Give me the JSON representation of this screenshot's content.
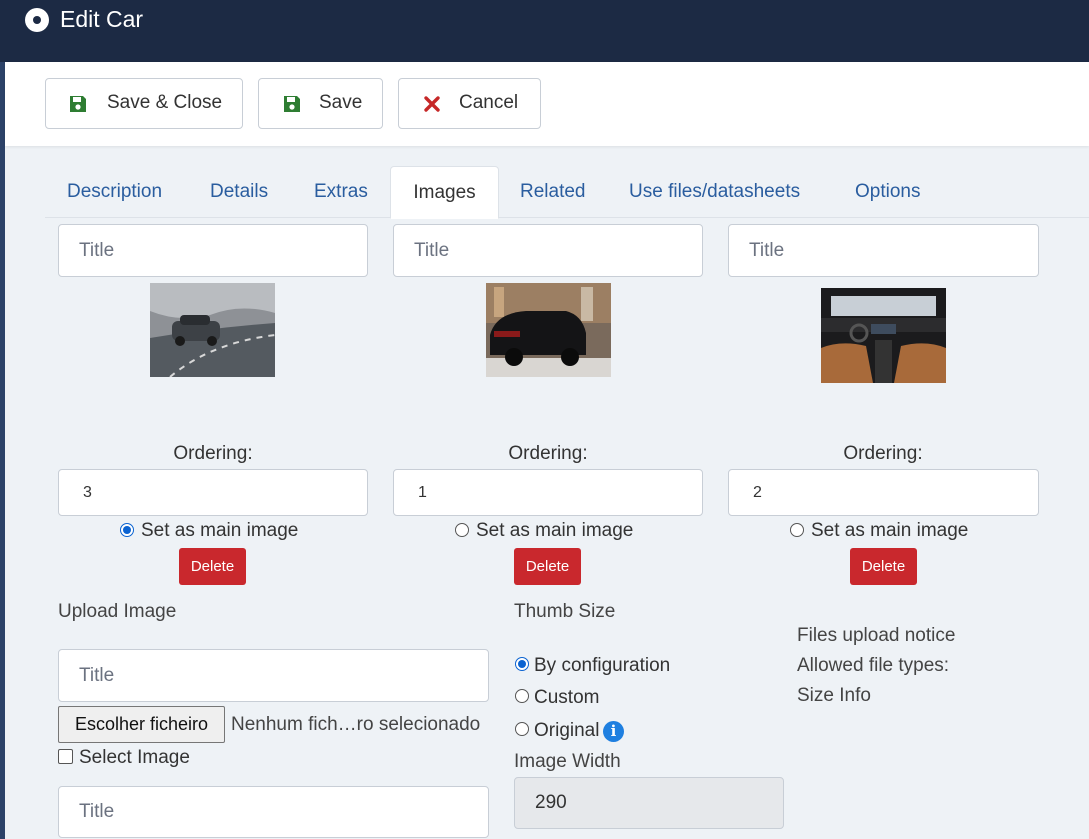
{
  "header": {
    "title": "Edit Car"
  },
  "toolbar": {
    "save_close": "Save & Close",
    "save": "Save",
    "cancel": "Cancel"
  },
  "tabs": [
    "Description",
    "Details",
    "Extras",
    "Images",
    "Related",
    "Use files/datasheets",
    "Options"
  ],
  "active_tab": "Images",
  "images": [
    {
      "title_placeholder": "Title",
      "ordering_label": "Ordering:",
      "ordering": "3",
      "main_label": "Set as main image",
      "is_main": true,
      "delete": "Delete"
    },
    {
      "title_placeholder": "Title",
      "ordering_label": "Ordering:",
      "ordering": "1",
      "main_label": "Set as main image",
      "is_main": false,
      "delete": "Delete"
    },
    {
      "title_placeholder": "Title",
      "ordering_label": "Ordering:",
      "ordering": "2",
      "main_label": "Set as main image",
      "is_main": false,
      "delete": "Delete"
    }
  ],
  "upload": {
    "heading": "Upload Image",
    "title_placeholder": "Title",
    "file_button": "Escolher ficheiro",
    "file_status": "Nenhum fich…ro selecionado",
    "select_image": "Select Image",
    "title_placeholder_2": "Title"
  },
  "thumb_size": {
    "heading": "Thumb Size",
    "options": [
      "By configuration",
      "Custom",
      "Original"
    ],
    "selected": "By configuration",
    "width_label": "Image Width",
    "width_value": "290"
  },
  "notice": {
    "line1": "Files upload notice",
    "line2": "Allowed file types:",
    "line3": "Size Info"
  },
  "colors": {
    "header": "#1c2a44",
    "link": "#2a5d9f",
    "danger": "#c9282d",
    "save_icon": "#2e7d32",
    "cancel_icon": "#c62828"
  }
}
